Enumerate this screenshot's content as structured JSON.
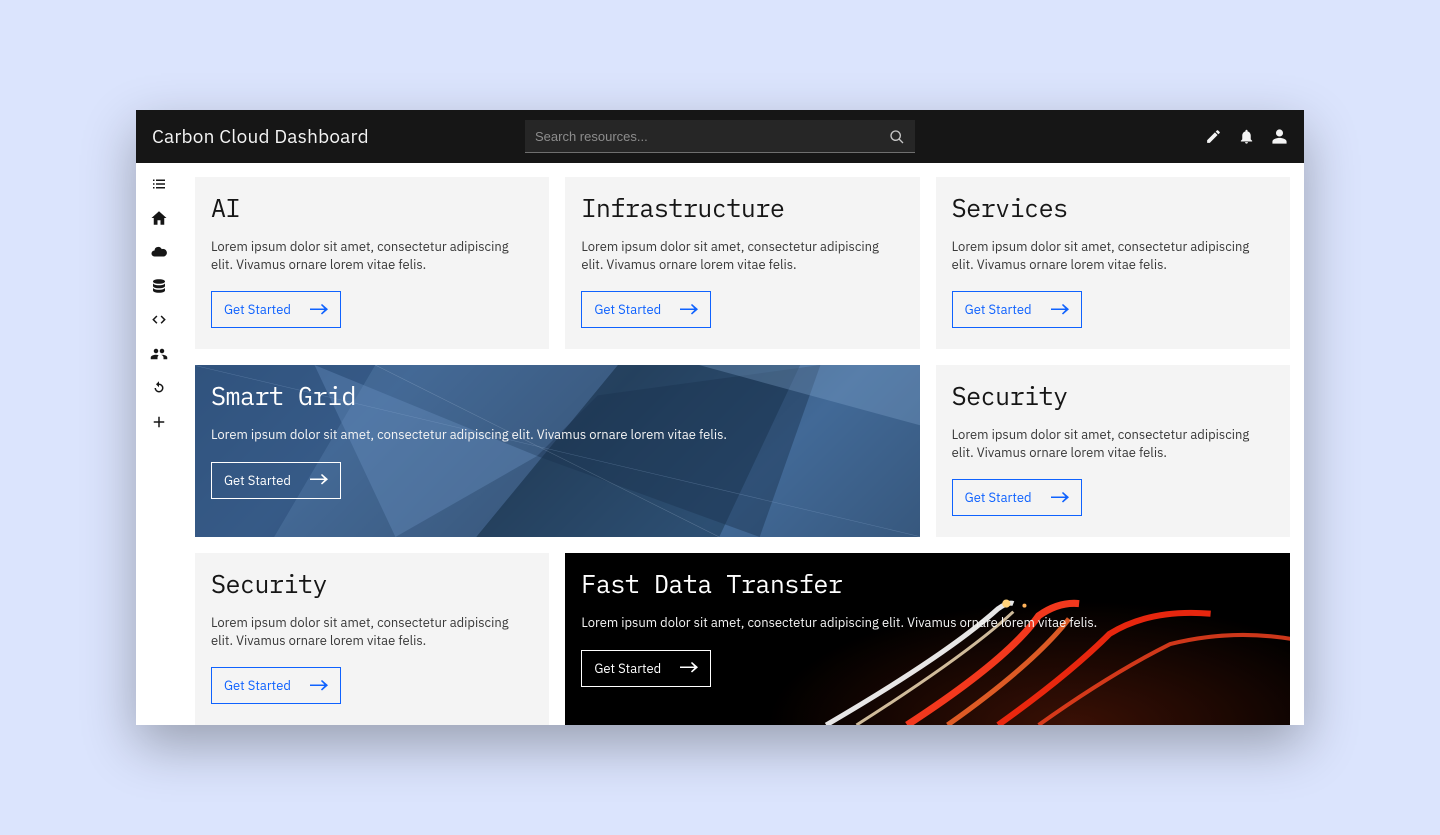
{
  "header": {
    "title": "Carbon Cloud Dashboard",
    "search_placeholder": "Search resources..."
  },
  "sidebar": {
    "items": [
      {
        "name": "list-icon"
      },
      {
        "name": "home-icon"
      },
      {
        "name": "cloud-icon"
      },
      {
        "name": "database-icon"
      },
      {
        "name": "code-icon"
      },
      {
        "name": "users-icon"
      },
      {
        "name": "refresh-icon"
      },
      {
        "name": "add-icon"
      }
    ]
  },
  "cards": {
    "ai": {
      "title": "AI",
      "desc": "Lorem ipsum dolor sit amet, consectetur adipiscing elit. Vivamus ornare lorem vitae felis.",
      "cta": "Get Started"
    },
    "infra": {
      "title": "Infrastructure",
      "desc": "Lorem ipsum dolor sit amet, consectetur adipiscing elit. Vivamus ornare lorem vitae felis.",
      "cta": "Get Started"
    },
    "services": {
      "title": "Services",
      "desc": "Lorem ipsum dolor sit amet, consectetur adipiscing elit. Vivamus ornare lorem vitae felis.",
      "cta": "Get Started"
    },
    "smartgrid": {
      "title": "Smart Grid",
      "desc": "Lorem ipsum dolor sit amet, consectetur adipiscing elit. Vivamus ornare lorem vitae felis.",
      "cta": "Get Started"
    },
    "security": {
      "title": "Security",
      "desc": "Lorem ipsum dolor sit amet, consectetur adipiscing elit. Vivamus ornare lorem vitae felis.",
      "cta": "Get Started"
    },
    "security2": {
      "title": "Security",
      "desc": "Lorem ipsum dolor sit amet, consectetur adipiscing elit. Vivamus ornare lorem vitae felis.",
      "cta": "Get Started"
    },
    "fastdata": {
      "title": "Fast Data Transfer",
      "desc": "Lorem ipsum dolor sit amet, consectetur adipiscing elit. Vivamus ornare lorem vitae felis.",
      "cta": "Get Started"
    }
  },
  "colors": {
    "accent": "#0f62fe",
    "page_bg": "#dbe4fd",
    "card_bg": "#f4f4f4",
    "header_bg": "#161616"
  }
}
